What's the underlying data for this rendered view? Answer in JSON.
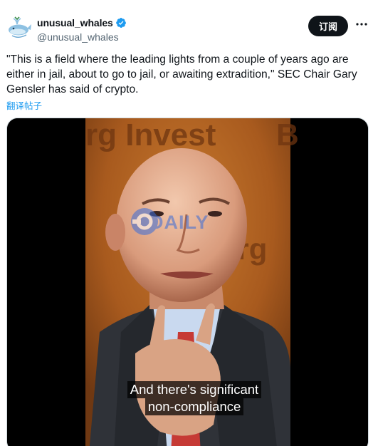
{
  "account": {
    "display_name": "unusual_whales",
    "handle": "@unusual_whales",
    "verified": true,
    "avatar": "whale-logo"
  },
  "actions": {
    "subscribe_label": "订阅",
    "more_icon": "more-horizontal-icon"
  },
  "tweet": {
    "text": "\"This is a field where the leading lights from a couple of years ago are either in jail, about to go to jail, or awaiting extradition,\" SEC Chair Gary Gensler has said of crypto.",
    "translate_label": "翻译帖子"
  },
  "video": {
    "background_sign": "rg Invest",
    "background_sign_right": "B",
    "background_sign_lower": "erg",
    "caption_line1": "And there's significant",
    "caption_line2": "non-compliance",
    "watermark": "ODAILY"
  },
  "colors": {
    "accent": "#1d9bf0",
    "subscribe_bg": "#0f1419",
    "text_primary": "#0f1419",
    "text_secondary": "#536471",
    "verified": "#1d9bf0"
  }
}
